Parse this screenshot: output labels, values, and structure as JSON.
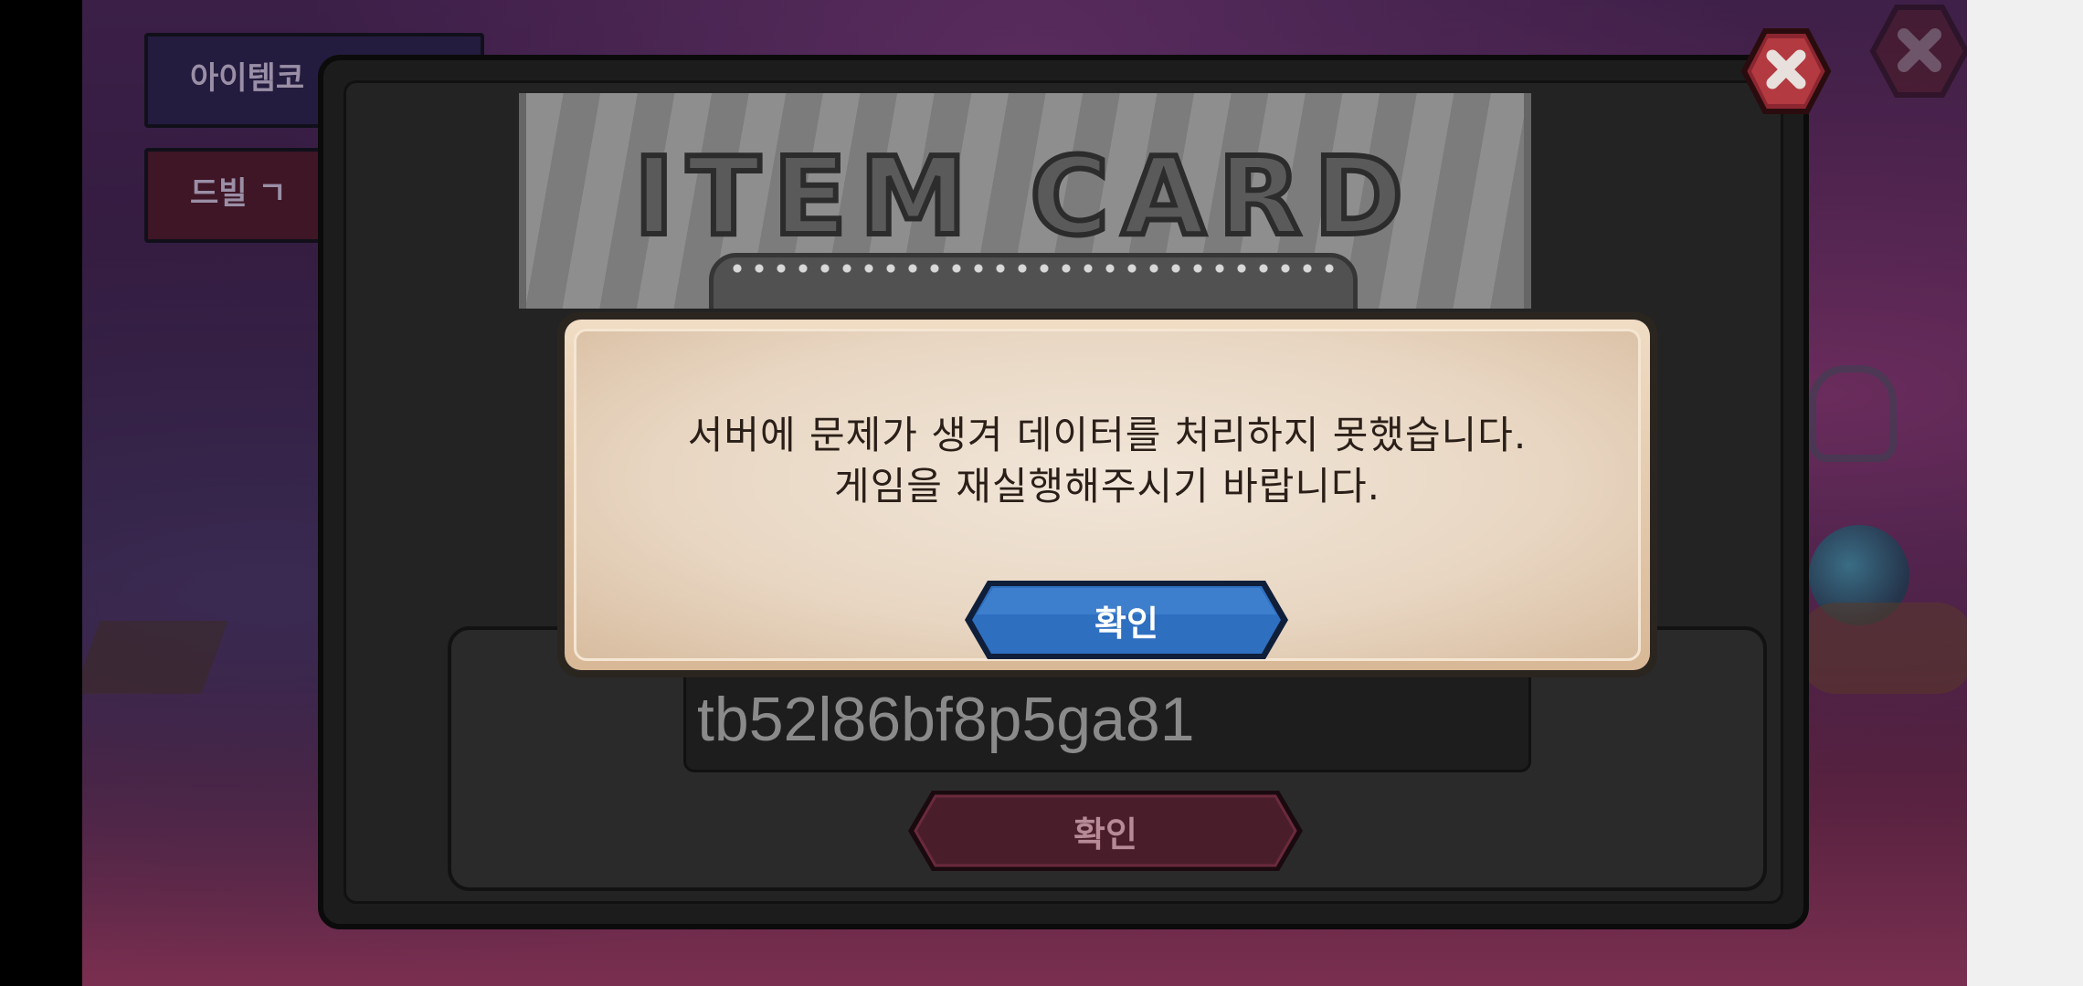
{
  "background": {
    "tab_item_code": "아이템코",
    "tab_red": "드빌 ㄱ"
  },
  "item_card": {
    "banner_title": "ITEM CARD",
    "code_value": "tb52l86bf8p5ga81",
    "submit_label": "확인"
  },
  "dialog": {
    "message_line1": "서버에 문제가 생겨 데이터를 처리하지 못했습니다.",
    "message_line2": "게임을 재실행해주시기 바랍니다.",
    "ok_label": "확인"
  },
  "colors": {
    "dialog_button": "#2f6fc0",
    "submit_button": "#4a1d2b",
    "close_button": "#8b2630"
  },
  "icons": [
    "close-icon",
    "close-icon"
  ]
}
